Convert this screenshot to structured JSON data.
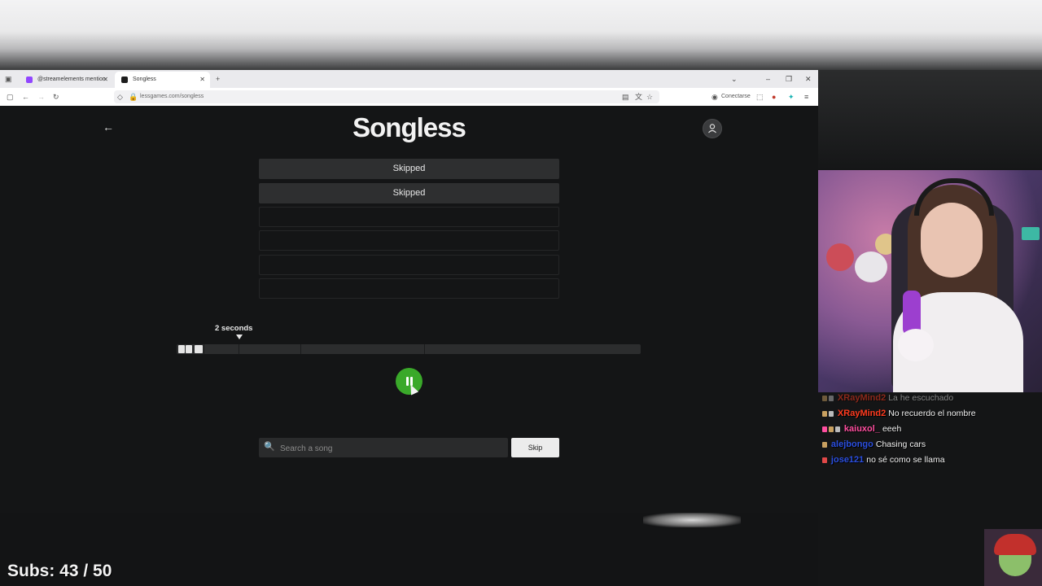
{
  "browser": {
    "tabs": [
      {
        "label": "@streamelements mention",
        "active": false
      },
      {
        "label": "Songless",
        "active": true
      }
    ],
    "new_tab_symbol": "+",
    "url": "lessgames.com/songless",
    "connect_label": "Conectarse"
  },
  "app": {
    "logo": "Songless",
    "back_icon": "arrow-left-icon",
    "user_icon": "user-icon"
  },
  "guesses": [
    {
      "label": "Skipped"
    },
    {
      "label": "Skipped"
    },
    {
      "label": ""
    },
    {
      "label": ""
    },
    {
      "label": ""
    },
    {
      "label": ""
    }
  ],
  "timeline": {
    "label": "2 seconds",
    "played_segments": 2
  },
  "player": {
    "state": "playing",
    "button_icon": "pause-icon",
    "accent_color": "#3aa92a"
  },
  "search": {
    "placeholder": "Search a song",
    "value": "",
    "skip_label": "Skip"
  },
  "overlay": {
    "subs_text": "Subs: 43 / 50"
  },
  "chat": [
    {
      "user": "XRayMind2",
      "user_color": "#ff3b1f",
      "message": "La he escuchado",
      "faded": true
    },
    {
      "user": "XRayMind2",
      "user_color": "#ff3b1f",
      "message": "No recuerdo el nombre",
      "faded": false
    },
    {
      "user": "kaiuxol_",
      "user_color": "#ff4fa0",
      "message": "eeeh",
      "faded": false
    },
    {
      "user": "alejbongo",
      "user_color": "#2b4fe0",
      "message": "Chasing cars",
      "faded": false
    },
    {
      "user": "jose121",
      "user_color": "#2b4fe0",
      "message": "no sé como se llama",
      "faded": false
    }
  ]
}
